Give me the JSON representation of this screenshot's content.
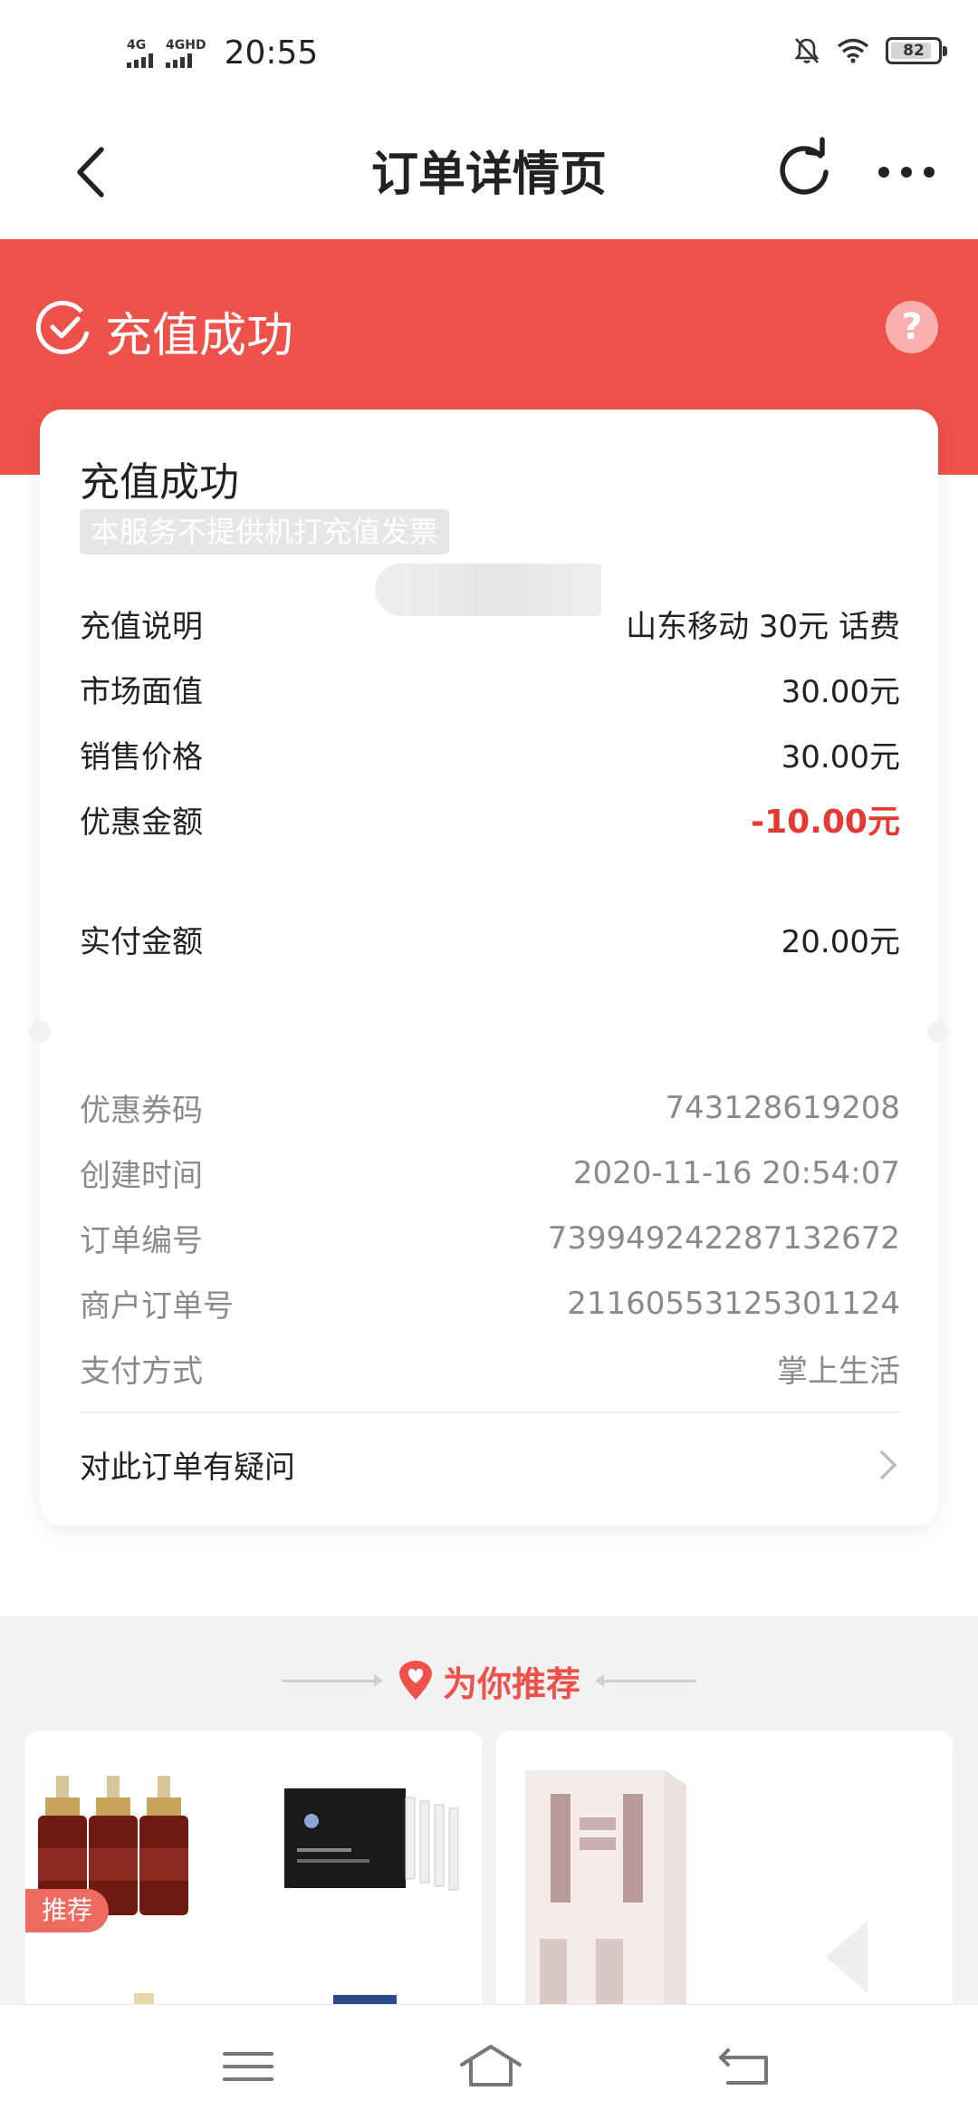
{
  "status_bar": {
    "sim1_label": "4G",
    "sim2_label": "4GHD",
    "time": "20:55",
    "battery": "82",
    "icons": [
      "mute-bell-icon",
      "wifi-icon",
      "battery-icon"
    ]
  },
  "nav": {
    "title": "订单详情页",
    "icons": [
      "back-icon",
      "refresh-icon",
      "more-icon"
    ]
  },
  "banner": {
    "status": "充值成功",
    "help": "?"
  },
  "card": {
    "title": "充值成功",
    "invoice_note": "本服务不提供机打充值发票",
    "recharge_desc_label": "充值说明",
    "recharge_desc_value": "山东移动 30元 话费",
    "market_value_label": "市场面值",
    "market_value": "30.00元",
    "sale_price_label": "销售价格",
    "sale_price": "30.00元",
    "discount_label": "优惠金额",
    "discount": "-10.00元",
    "paid_label": "实付金额",
    "paid": "20.00元",
    "coupon_label": "优惠券码",
    "coupon": "743128619208",
    "created_label": "创建时间",
    "created": "2020-11-16 20:54:07",
    "order_no_label": "订单编号",
    "order_no": "739949242287132672",
    "merchant_no_label": "商户订单号",
    "merchant_no": "21160553125301124",
    "pay_method_label": "支付方式",
    "pay_method": "掌上生活",
    "question": "对此订单有疑问"
  },
  "recommend": {
    "title": "为你推荐",
    "badge": "推荐",
    "accent": "#ee514a"
  },
  "colors": {
    "banner": "#ee514a",
    "discount": "#e43a31"
  },
  "bottom_nav": {
    "icons": [
      "menu-icon",
      "home-icon",
      "return-icon"
    ]
  }
}
